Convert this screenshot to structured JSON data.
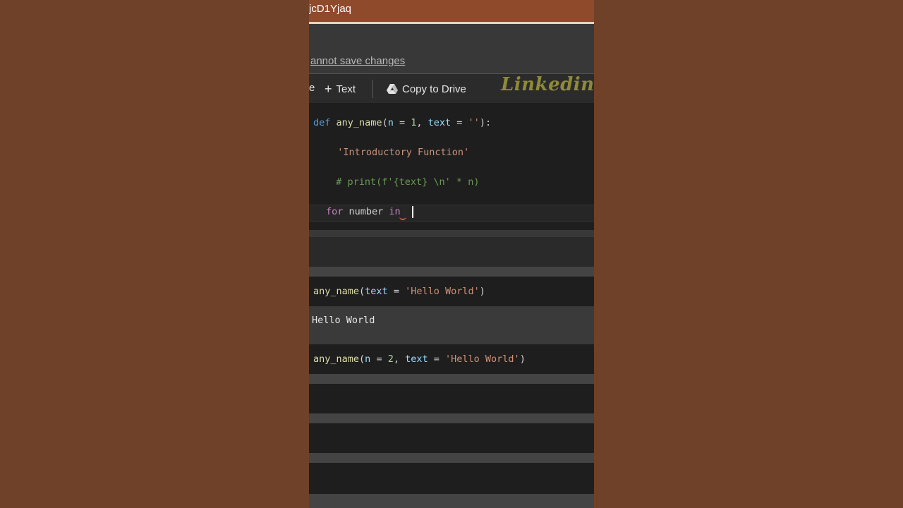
{
  "titlebar": {
    "text": "jcD1Yjaq"
  },
  "notice": {
    "text": "annot save changes"
  },
  "toolbar": {
    "cut_label": "e",
    "text_button_label": "Text",
    "drive_button_label": "Copy to Drive",
    "watermark": "Linkedin.c"
  },
  "cell1": {
    "lines": [
      "def any_name(n = 1, text = ''):",
      "  'Introductory Function'",
      "  # print(f'{text} \\n' * n)",
      "  for number in "
    ]
  },
  "cell2": {
    "code": "any_name(text = 'Hello World')",
    "output": "Hello World"
  },
  "cell3": {
    "code": "any_name(n = 2, text = 'Hello World')"
  },
  "colors": {
    "background": "#6f4129",
    "titlebar": "#8e4a2a",
    "editor": "#1e1e1e",
    "keyword": "#569cd6",
    "string": "#ce9178",
    "comment": "#6a9955",
    "number": "#b5cea8",
    "watermark": "#8e8a3a"
  },
  "icons": [
    "plus-icon",
    "drive-icon"
  ]
}
